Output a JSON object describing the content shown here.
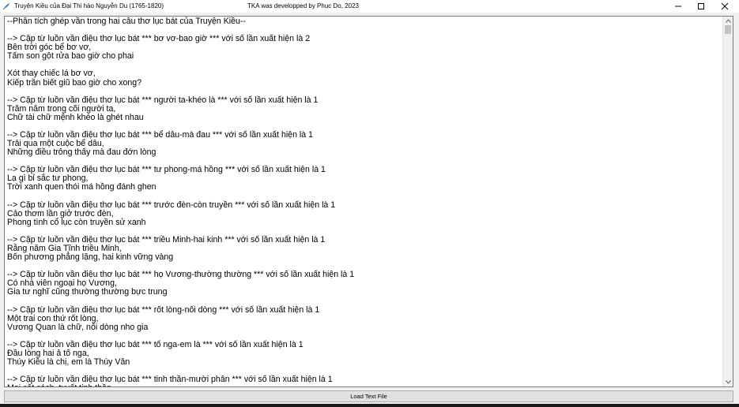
{
  "window": {
    "title": "Truyện Kiều của Đại Thi hào Nguyễn Du (1765-1820)",
    "center_title": "TKA was developped by Phuc Do, 2023",
    "buttons": [
      "minimize-icon",
      "maximize-icon",
      "close-icon"
    ]
  },
  "text_area": {
    "content": "--Phân tích ghép vần trong hai câu thơ lục bát của Truyện Kiều--\n\n--> Cặp từ luồn vần điệu thơ lục bát *** bơ vơ-bao giờ *** với số lần xuất hiện là 2\nBên trời góc bể bơ vơ,\nTấm son gột rửa bao giờ cho phai\n\nXót thay chiếc lá bơ vơ,\nKiếp trần biết giũ bao giờ cho xong?\n\n--> Cặp từ luồn vần điệu thơ lục bát *** người ta-khéo là *** với số lần xuất hiện là 1\nTrăm năm trong cõi người ta,\nChữ tài chữ mệnh khéo là ghét nhau\n\n--> Cặp từ luồn vần điệu thơ lục bát *** bể dâu-mà đau *** với số lần xuất hiện là 1\nTrải qua một cuộc bể dâu,\nNhững điều trông thấy mà đau đớn lòng\n\n--> Cặp từ luồn vần điệu thơ lục bát *** tư phong-má hồng *** với số lần xuất hiện là 1\nLạ gì bỉ sắc tư phong,\nTrời xanh quen thói má hồng đánh ghen\n\n--> Cặp từ luồn vần điệu thơ lục bát *** trước đèn-còn truyền *** với số lần xuất hiện là 1\nCảo thơm lần giở trước đèn,\nPhong tình cổ lục còn truyền sử xanh\n\n--> Cặp từ luồn vần điệu thơ lục bát *** triều Minh-hai kinh *** với số lần xuất hiện là 1\nRằng năm Gia Tĩnh triều Minh,\nBốn phương phẳng lặng, hai kinh vững vàng\n\n--> Cặp từ luồn vần điệu thơ lục bát *** họ Vương-thường thường *** với số lần xuất hiện là 1\nCó nhà viên ngoại họ Vương,\nGia tư nghĩ cũng thường thường bực trung\n\n--> Cặp từ luồn vần điệu thơ lục bát *** rốt lòng-nối dòng *** với số lần xuất hiện là 1\nMột trai con thứ rốt lòng,\nVương Quan là chữ, nối dòng nho gia\n\n--> Cặp từ luồn vần điệu thơ lục bát *** tố nga-em là *** với số lần xuất hiện là 1\nĐầu lòng hai ả tố nga,\nThúy Kiều là chị, em là Thúy Vân\n\n--> Cặp từ luồn vần điệu thơ lục bát *** tinh thần-mười phân *** với số lần xuất hiện là 1\nMai cốt cách, tuyết tinh thần,"
  },
  "scrollbar": {
    "up_icon": "chevron-up-icon",
    "down_icon": "chevron-down-icon"
  },
  "load_button": {
    "label": "Load Text File"
  }
}
